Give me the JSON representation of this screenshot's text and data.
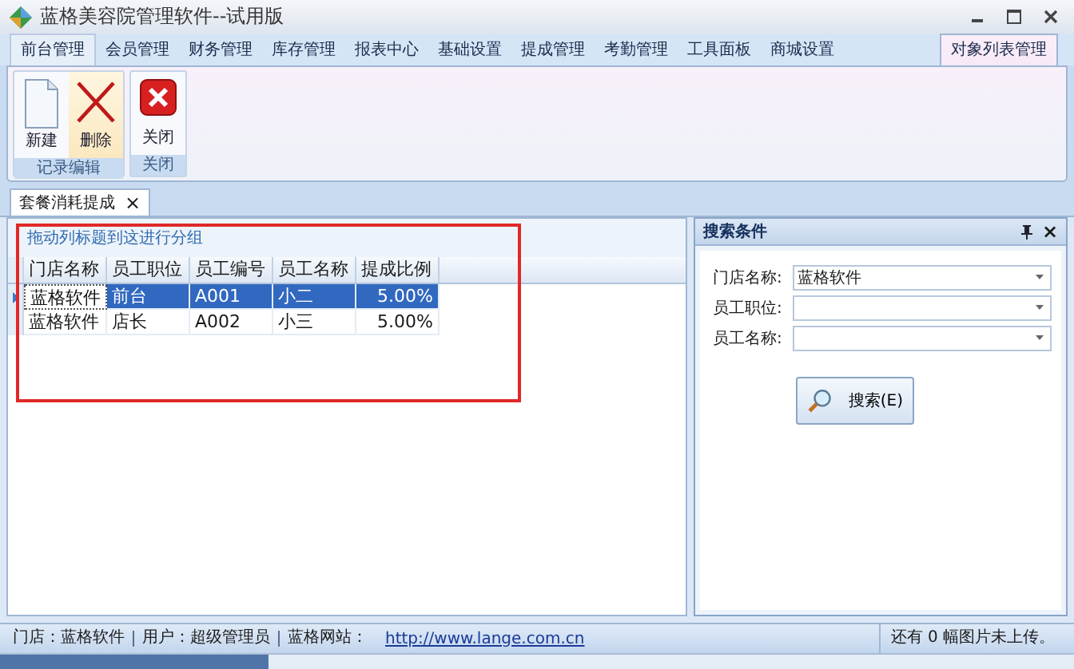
{
  "window": {
    "title": "蓝格美容院管理软件--试用版"
  },
  "ribbon": {
    "tabs": [
      {
        "label": "前台管理",
        "selected": false
      },
      {
        "label": "会员管理",
        "selected": false
      },
      {
        "label": "财务管理",
        "selected": false
      },
      {
        "label": "库存管理",
        "selected": false
      },
      {
        "label": "报表中心",
        "selected": false
      },
      {
        "label": "基础设置",
        "selected": false
      },
      {
        "label": "提成管理",
        "selected": false
      },
      {
        "label": "考勤管理",
        "selected": false
      },
      {
        "label": "工具面板",
        "selected": false
      },
      {
        "label": "商城设置",
        "selected": false
      },
      {
        "label": "对象列表管理",
        "selected": true
      }
    ],
    "groups": [
      {
        "label": "记录编辑",
        "buttons": [
          {
            "label": "新建",
            "kind": "new",
            "hovered": false
          },
          {
            "label": "删除",
            "kind": "delete",
            "hovered": true
          }
        ]
      },
      {
        "label": "关闭",
        "buttons": [
          {
            "label": "关闭",
            "kind": "close",
            "hovered": false
          }
        ]
      }
    ]
  },
  "document_tabs": [
    {
      "label": "套餐消耗提成",
      "close": "×",
      "selected": true
    }
  ],
  "grid": {
    "group_hint": "拖动列标题到这进行分组",
    "columns": [
      "门店名称",
      "员工职位",
      "员工编号",
      "员工名称",
      "提成比例"
    ],
    "rows": [
      {
        "cells": [
          "蓝格软件",
          "前台",
          "A001",
          "小二",
          "5.00%"
        ],
        "selected": true
      },
      {
        "cells": [
          "蓝格软件",
          "店长",
          "A002",
          "小三",
          "5.00%"
        ],
        "selected": false
      }
    ]
  },
  "search_panel": {
    "title": "搜索条件",
    "close": "×",
    "fields": [
      {
        "label": "门店名称:",
        "value": "蓝格软件"
      },
      {
        "label": "员工职位:"
      },
      {
        "label": "员工名称:"
      }
    ],
    "button": "搜索(E)"
  },
  "status_bar": {
    "items": [
      "门店：蓝格软件",
      "用户：超级管理员",
      "蓝格网站："
    ],
    "link": "http://www.lange.com.cn",
    "message": "还有 0 幅图片未上传。"
  },
  "progress": {
    "level": 0.25
  }
}
